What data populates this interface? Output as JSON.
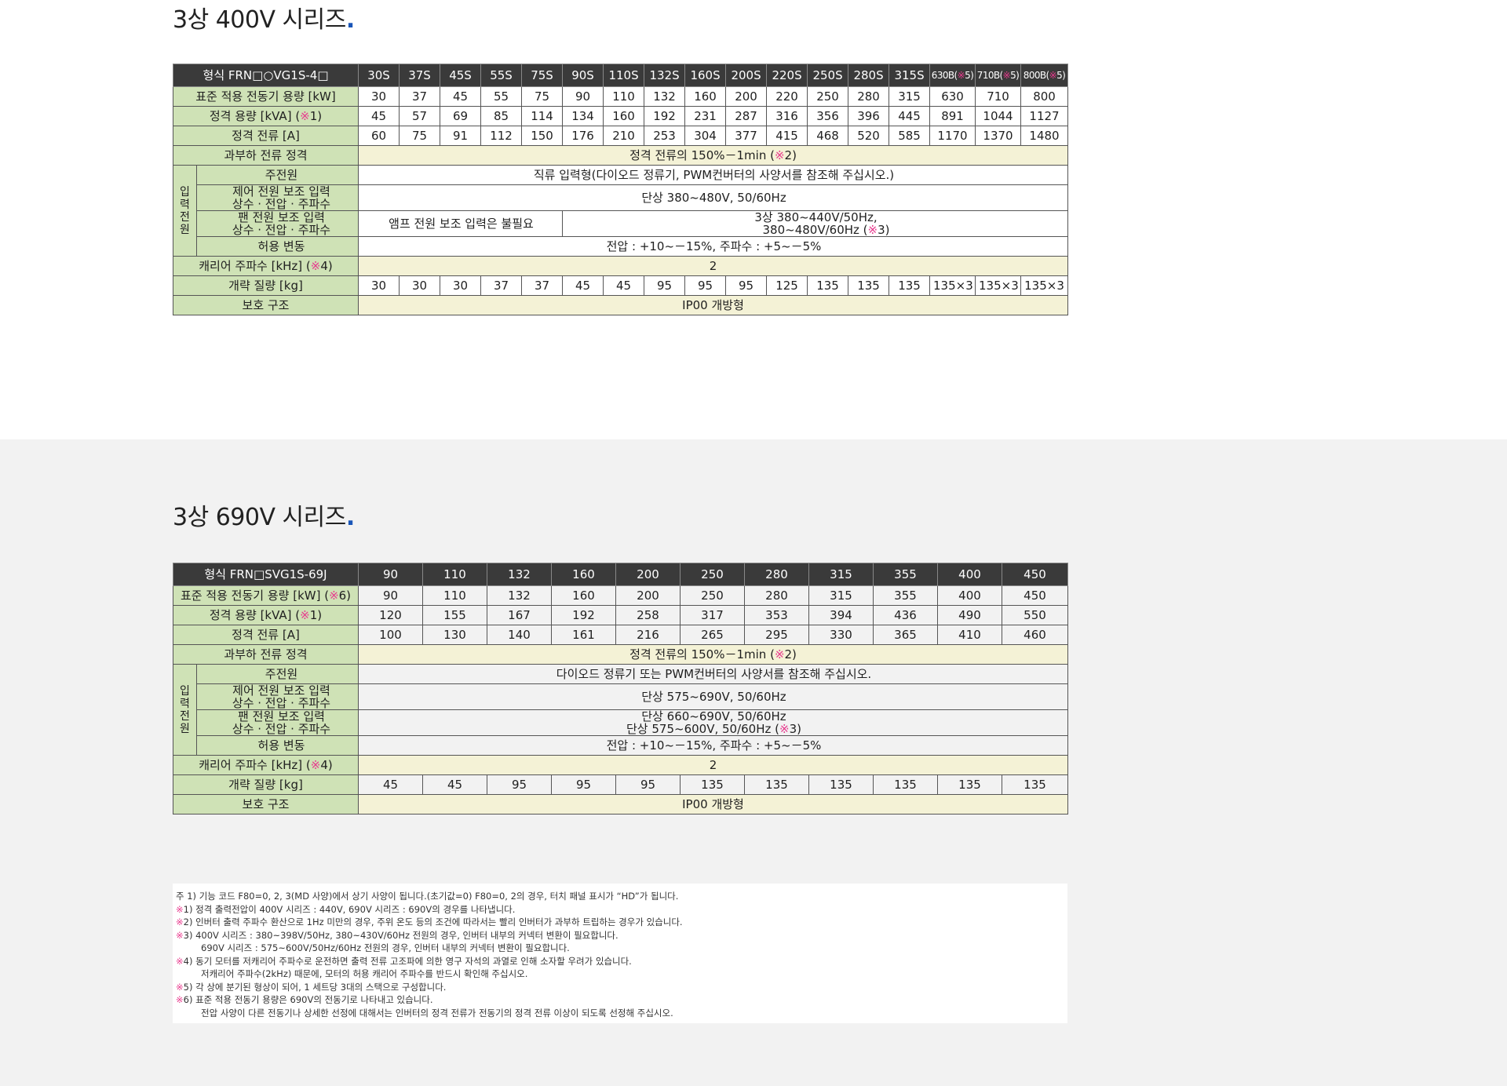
{
  "s400": {
    "heading": "3상 400V 시리즈",
    "heading_dot": ".",
    "model_label": "형식 FRN□○VG1S-4□",
    "models": [
      "30S",
      "37S",
      "45S",
      "55S",
      "75S",
      "90S",
      "110S",
      "132S",
      "160S",
      "200S",
      "220S",
      "250S",
      "280S",
      "315S"
    ],
    "models_marked": [
      {
        "pre": "630B(",
        "mark": "※",
        "post": "5)"
      },
      {
        "pre": "710B(",
        "mark": "※",
        "post": "5)"
      },
      {
        "pre": "800B(",
        "mark": "※",
        "post": "5)"
      }
    ],
    "motor_label": "표준 적용 전동기 용량 [kW]",
    "motor": [
      "30",
      "37",
      "45",
      "55",
      "75",
      "90",
      "110",
      "132",
      "160",
      "200",
      "220",
      "250",
      "280",
      "315",
      "630",
      "710",
      "800"
    ],
    "kva_label_pre": "정격 용량 [kVA] (",
    "kva_label_mark": "※",
    "kva_label_post": "1)",
    "kva": [
      "45",
      "57",
      "69",
      "85",
      "114",
      "134",
      "160",
      "192",
      "231",
      "287",
      "316",
      "356",
      "396",
      "445",
      "891",
      "1044",
      "1127"
    ],
    "amp_label": "정격 전류 [A]",
    "amp": [
      "60",
      "75",
      "91",
      "112",
      "150",
      "176",
      "210",
      "253",
      "304",
      "377",
      "415",
      "468",
      "520",
      "585",
      "1170",
      "1370",
      "1480"
    ],
    "overload_label": "과부하 전류 정격",
    "overload_pre": "정격 전류의 150%－1min (",
    "overload_mark": "※",
    "overload_post": "2)",
    "input_group": "입력전원",
    "main_power_label": "주전원",
    "main_power": "직류 입력형(다이오드 정류기, PWM컨버터의 사양서를 참조해 주십시오.)",
    "ctrl_label_1": "제어 전원 보조 입력",
    "ctrl_label_2": "상수 · 전압 · 주파수",
    "ctrl_value": "단상 380~480V, 50/60Hz",
    "fan_label_1": "팬 전원 보조 입력",
    "fan_label_2": "상수 · 전압 · 주파수",
    "fan_value_a": "앰프 전원 보조 입력은 불필요",
    "fan_value_b1": "3상 380~440V/50Hz,",
    "fan_value_b2_pre": "380~480V/60Hz (",
    "fan_value_b2_mark": "※",
    "fan_value_b2_post": "3)",
    "tol_label": "허용 변동",
    "tol_value": "전압 : +10~－15%, 주파수 : +5~－5%",
    "carrier_label_pre": "캐리어 주파수 [kHz] (",
    "carrier_label_mark": "※",
    "carrier_label_post": "4)",
    "carrier_value": "2",
    "mass_label": "개략 질량 [kg]",
    "mass": [
      "30",
      "30",
      "30",
      "37",
      "37",
      "45",
      "45",
      "95",
      "95",
      "95",
      "125",
      "135",
      "135",
      "135",
      "135×3",
      "135×3",
      "135×3"
    ],
    "prot_label": "보호 구조",
    "prot_value": "IP00 개방형"
  },
  "s690": {
    "heading": "3상 690V 시리즈",
    "heading_dot": ".",
    "model_label": "형식 FRN□SVG1S-69J",
    "models": [
      "90",
      "110",
      "132",
      "160",
      "200",
      "250",
      "280",
      "315",
      "355",
      "400",
      "450"
    ],
    "motor_label_pre": "표준 적용 전동기 용량 [kW] (",
    "motor_label_mark": "※",
    "motor_label_post": "6)",
    "motor": [
      "90",
      "110",
      "132",
      "160",
      "200",
      "250",
      "280",
      "315",
      "355",
      "400",
      "450"
    ],
    "kva_label_pre": "정격 용량 [kVA] (",
    "kva_label_mark": "※",
    "kva_label_post": "1)",
    "kva": [
      "120",
      "155",
      "167",
      "192",
      "258",
      "317",
      "353",
      "394",
      "436",
      "490",
      "550"
    ],
    "amp_label": "정격 전류 [A]",
    "amp": [
      "100",
      "130",
      "140",
      "161",
      "216",
      "265",
      "295",
      "330",
      "365",
      "410",
      "460"
    ],
    "overload_label": "과부하 전류 정격",
    "overload_pre": "정격 전류의 150%－1min (",
    "overload_mark": "※",
    "overload_post": "2)",
    "input_group": "입력전원",
    "main_power_label": "주전원",
    "main_power": "다이오드 정류기 또는 PWM컨버터의 사양서를 참조해 주십시오.",
    "ctrl_label_1": "제어 전원 보조 입력",
    "ctrl_label_2": "상수 · 전압 · 주파수",
    "ctrl_value": "단상 575~690V, 50/60Hz",
    "fan_label_1": "팬 전원 보조 입력",
    "fan_label_2": "상수 · 전압 · 주파수",
    "fan_value_1": "단상 660~690V, 50/60Hz",
    "fan_value_2_pre": "단상 575~600V, 50/60Hz (",
    "fan_value_2_mark": "※",
    "fan_value_2_post": "3)",
    "tol_label": "허용 변동",
    "tol_value": "전압 : +10~－15%, 주파수 : +5~－5%",
    "carrier_label_pre": "캐리어 주파수 [kHz] (",
    "carrier_label_mark": "※",
    "carrier_label_post": "4)",
    "carrier_value": "2",
    "mass_label": "개략 질량 [kg]",
    "mass": [
      "45",
      "45",
      "95",
      "95",
      "95",
      "135",
      "135",
      "135",
      "135",
      "135",
      "135"
    ],
    "prot_label": "보호 구조",
    "prot_value": "IP00 개방형"
  },
  "notes": [
    {
      "mark": "",
      "text": "주 1)  기능 코드 F80=0, 2, 3(MD 사양)에서 상기 사양이 됩니다.(초기값=0) F80=0, 2의 경우, 터치 패널 표시가 “HD”가 됩니다."
    },
    {
      "mark": "※",
      "text": "1)  정격 출력전압이 400V 시리즈 : 440V, 690V 시리즈 : 690V의 경우를 나타냅니다."
    },
    {
      "mark": "※",
      "text": "2)  인버터 출력 주파수 환산으로 1Hz 미만의 경우, 주위 온도 등의 조건에 따라서는 빨리 인버터가 과부하 트립하는 경우가 있습니다."
    },
    {
      "mark": "※",
      "text": "3)  400V 시리즈 : 380~398V/50Hz, 380~430V/60Hz 전원의 경우, 인버터 내부의 커넥터 변환이 필요합니다."
    },
    {
      "mark": "",
      "text": "690V 시리즈 : 575~600V/50Hz/60Hz 전원의 경우, 인버터 내부의 커넥터 변환이 필요합니다.",
      "indent": true
    },
    {
      "mark": "※",
      "text": "4)  동기 모터를 저캐리어 주파수로 운전하면 출력 전류 고조파에 의한 영구 자석의 과열로 인해 소자할 우려가 있습니다."
    },
    {
      "mark": "",
      "text": "저캐리어 주파수(2kHz) 때문에, 모터의 허용 캐리어 주파수를 반드시 확인해 주십시오.",
      "indent": true
    },
    {
      "mark": "※",
      "text": "5)  각 상에 분기된 형상이 되어, 1 세트당 3대의 스택으로 구성합니다."
    },
    {
      "mark": "※",
      "text": "6)  표준 적용 전동기 용량은 690V의 전동기로 나타내고 있습니다."
    },
    {
      "mark": "",
      "text": "전압 사양이 다른 전동기나 상세한 선정에 대해서는 인버터의 정격 전류가 전동기의 정격 전류 이상이 되도록 선정해 주십시오.",
      "indent": true
    }
  ]
}
